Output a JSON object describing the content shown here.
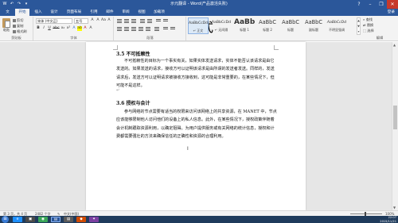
{
  "window": {
    "title": "示元翻译 - Word(产品激活失败)",
    "minimize": "–",
    "restore": "❐",
    "close": "✕",
    "help": "?"
  },
  "qat": [
    "W",
    "↶",
    "↷",
    "▾"
  ],
  "tabs": {
    "file": "文件",
    "items": [
      "开始",
      "插入",
      "设计",
      "页面布局",
      "引用",
      "邮件",
      "审阅",
      "视图",
      "加载项"
    ],
    "active_index": 0,
    "signin": "登录"
  },
  "ribbon": {
    "clipboard": {
      "paste": "粘贴",
      "cut": "剪切",
      "copy": "复制",
      "format_painter": "格式刷",
      "label": "剪贴板"
    },
    "font": {
      "name": "宋体 (中文正)",
      "size": "五号",
      "buttons_row1": [
        "A",
        "A",
        "Aa",
        "A"
      ],
      "buttons_row2": [
        "B",
        "I",
        "U",
        "abc",
        "x₂",
        "x²",
        "A",
        "ab",
        "A",
        "A"
      ],
      "label": "字体"
    },
    "paragraph": {
      "label": "段落"
    },
    "styles": {
      "items": [
        {
          "sample": "AaBbCcDd",
          "name": "↵ 正文"
        },
        {
          "sample": "AaBbCcDd",
          "name": "↵ 无间隔"
        },
        {
          "sample": "AaBb",
          "name": "标题 1"
        },
        {
          "sample": "AaBbC",
          "name": "标题 2"
        },
        {
          "sample": "AaBbC",
          "name": "标题"
        },
        {
          "sample": "AaBbC",
          "name": "副标题"
        },
        {
          "sample": "AaBbCcDd",
          "name": "不明显强调"
        }
      ],
      "label": "样式"
    },
    "editing": {
      "find": "查找",
      "replace": "替换",
      "select": "选择",
      "label": "编辑"
    }
  },
  "document": {
    "heading1": "3.5 不可抵赖性",
    "para1": "不可抵赖性的目标为一个事实有关，如果实体发送请求，实体不能否认该请求是由它发送的。如果发送的请求，接收方可以证明该请求是由所谓的发送者发送。同样的，发送请求后，发送方可以证明请求被接收方接收到，这可能是非常重要的，在某些情况下，但可能不是这样。",
    "return_mark": "↵",
    "heading2": "3.6 授权与会计",
    "para2": "参与网络的节点需要有适当的权限来访问该网络上的共享资源，在 MANET 中，节点应该能够限制他人访问他们的设备上的私人信息。此外，在某些情况下，授权政策伴随着会计机制跟踪资源利用，以确定阻碍。为用户提供服务或有关网络的统计信息，授权和计费都需要强壮的方法来确保信任的正确性和资源的合理利用。",
    "cursor": "I"
  },
  "statusbar": {
    "page": "第 3 页，共 4 页",
    "words": "2482 个字",
    "lang_icon": "✎",
    "language": "中文(中国)",
    "zoom": "100%"
  },
  "taskbar": {
    "apps": [
      {
        "label": "e",
        "color": "#1e90ff"
      },
      {
        "label": "▣",
        "color": "#4a4a4a"
      },
      {
        "label": "◉",
        "color": "#3aa657"
      },
      {
        "label": "W",
        "color": "#2b579a"
      },
      {
        "label": "▤",
        "color": "#5a5a5a"
      },
      {
        "label": "◆",
        "color": "#d04a02"
      },
      {
        "label": "✦",
        "color": "#7b3fa0"
      }
    ],
    "time": "22:07",
    "date": "2015/11/21"
  }
}
